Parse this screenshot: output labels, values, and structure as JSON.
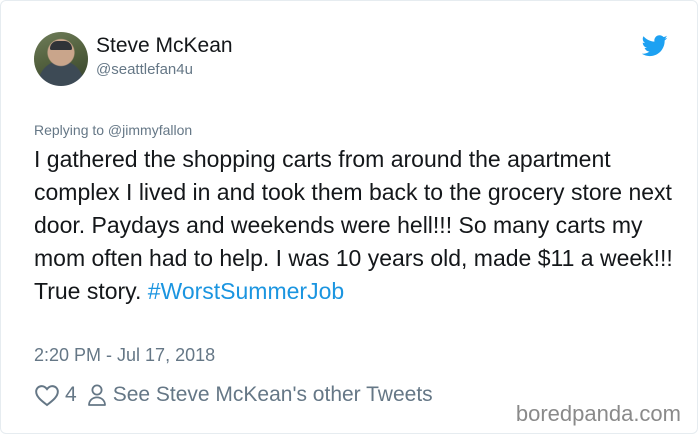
{
  "author": {
    "display_name": "Steve McKean",
    "handle": "@seattlefan4u"
  },
  "reply": {
    "label": "Replying to @jimmyfallon"
  },
  "tweet": {
    "body": "I gathered the shopping carts from around the apartment complex I lived in and took them back to the grocery store next door. Paydays and weekends were hell!!! So many carts my mom often had to help. I was 10 years old, made $11 a week!!! True story.",
    "hashtag": "#WorstSummerJob",
    "timestamp": "2:20 PM - Jul 17, 2018"
  },
  "actions": {
    "like_count": "4",
    "other_tweets_label": "See Steve McKean's other Tweets"
  },
  "watermark": "boredpanda.com",
  "colors": {
    "twitter_blue": "#1b95e0",
    "secondary_text": "#657786",
    "primary_text": "#14171a"
  },
  "icons": [
    "twitter-bird-icon",
    "heart-icon",
    "person-icon"
  ]
}
